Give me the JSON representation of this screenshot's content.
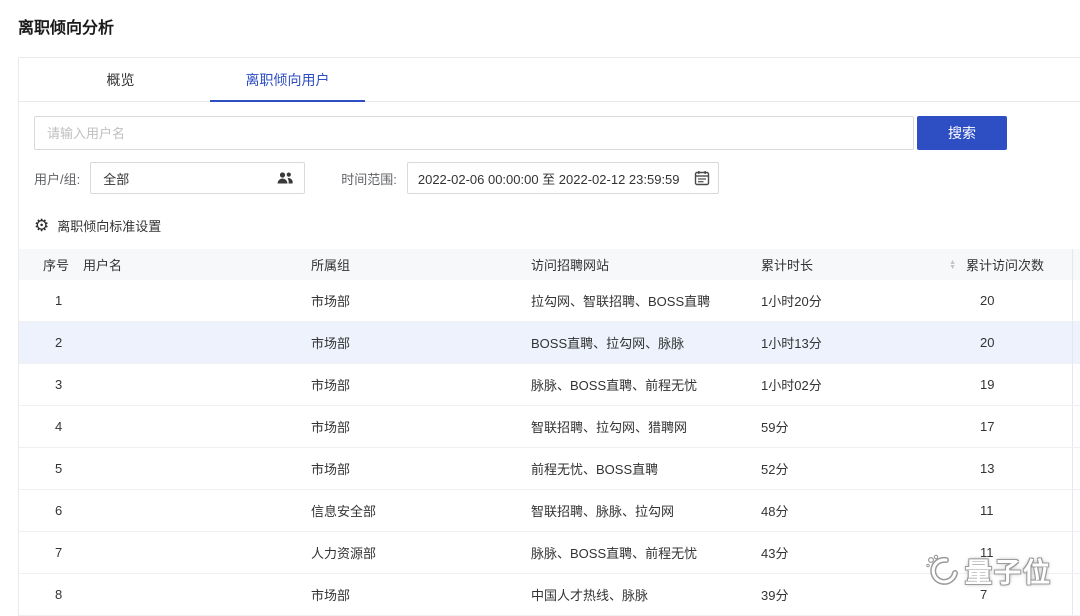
{
  "page": {
    "title": "离职倾向分析"
  },
  "tabs": {
    "overview": "概览",
    "users": "离职倾向用户"
  },
  "search": {
    "placeholder": "请输入用户名",
    "button_label": "搜索"
  },
  "filters": {
    "user_group_label": "用户/组:",
    "user_group_value": "全部",
    "time_range_label": "时间范围:",
    "time_range_value": "2022-02-06 00:00:00 至 2022-02-12 23:59:59"
  },
  "settings": {
    "label": "离职倾向标准设置"
  },
  "table": {
    "headers": {
      "index": "序号",
      "username": "用户名",
      "group": "所属组",
      "sites": "访问招聘网站",
      "duration": "累计时长",
      "visits": "累计访问次数"
    },
    "rows": [
      {
        "index": "1",
        "group": "市场部",
        "sites": "拉勾网、智联招聘、BOSS直聘",
        "duration": "1小时20分",
        "visits": "20"
      },
      {
        "index": "2",
        "group": "市场部",
        "sites": "BOSS直聘、拉勾网、脉脉",
        "duration": "1小时13分",
        "visits": "20"
      },
      {
        "index": "3",
        "group": "市场部",
        "sites": "脉脉、BOSS直聘、前程无忧",
        "duration": "1小时02分",
        "visits": "19"
      },
      {
        "index": "4",
        "group": "市场部",
        "sites": "智联招聘、拉勾网、猎聘网",
        "duration": "59分",
        "visits": "17"
      },
      {
        "index": "5",
        "group": "市场部",
        "sites": "前程无忧、BOSS直聘",
        "duration": "52分",
        "visits": "13"
      },
      {
        "index": "6",
        "group": "信息安全部",
        "sites": "智联招聘、脉脉、拉勾网",
        "duration": "48分",
        "visits": "11"
      },
      {
        "index": "7",
        "group": "人力资源部",
        "sites": "脉脉、BOSS直聘、前程无忧",
        "duration": "43分",
        "visits": "11"
      },
      {
        "index": "8",
        "group": "市场部",
        "sites": "中国人才热线、脉脉",
        "duration": "39分",
        "visits": "7"
      }
    ]
  },
  "watermark": {
    "label": "量子位"
  },
  "colors": {
    "accent": "#2e4fc4",
    "row_highlight": "#edf2fd",
    "header_bg": "#f7f8fa"
  }
}
